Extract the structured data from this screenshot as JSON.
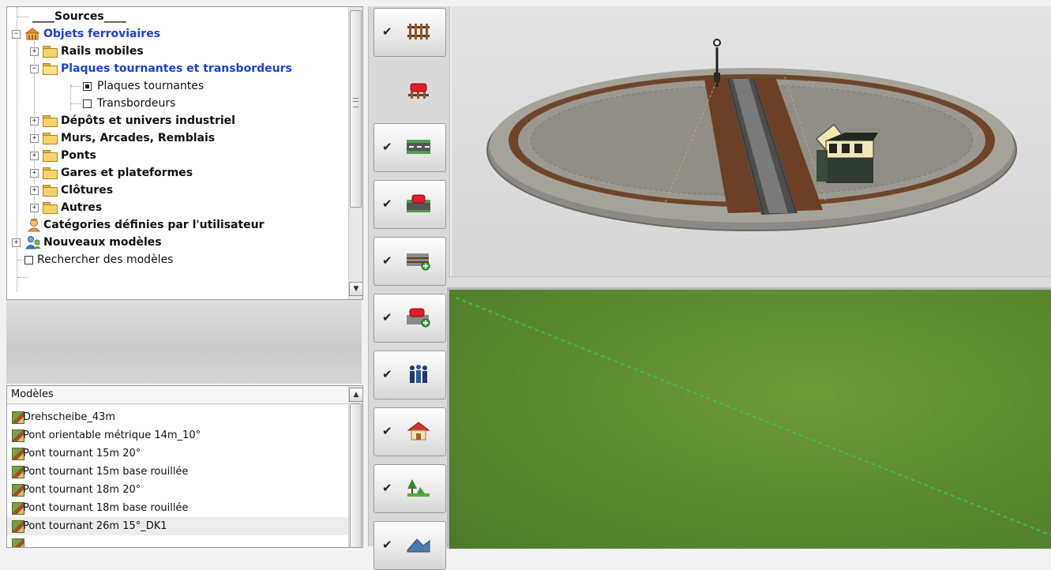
{
  "tree": {
    "items": [
      {
        "label": "____Sources____",
        "level": 1,
        "style": "bold",
        "icon": "none",
        "expander": "none"
      },
      {
        "label": "Objets ferroviaires",
        "level": 0,
        "style": "bold-blue",
        "icon": "railway-objects-icon",
        "expander": "minus"
      },
      {
        "label": "Rails mobiles",
        "level": 1,
        "style": "bold",
        "icon": "folder-icon",
        "expander": "plus"
      },
      {
        "label": "Plaques tournantes et transbordeurs",
        "level": 1,
        "style": "bold-blue",
        "icon": "folder-open-icon",
        "expander": "minus"
      },
      {
        "label": "Plaques tournantes",
        "level": 2,
        "style": "plain",
        "icon": "checkbox-checked",
        "expander": "none"
      },
      {
        "label": "Transbordeurs",
        "level": 2,
        "style": "plain",
        "icon": "checkbox-empty",
        "expander": "none"
      },
      {
        "label": "Dépôts et univers industriel",
        "level": 1,
        "style": "bold",
        "icon": "folder-icon",
        "expander": "plus"
      },
      {
        "label": "Murs, Arcades, Remblais",
        "level": 1,
        "style": "bold",
        "icon": "folder-icon",
        "expander": "plus"
      },
      {
        "label": "Ponts",
        "level": 1,
        "style": "bold",
        "icon": "folder-icon",
        "expander": "plus"
      },
      {
        "label": "Gares et plateformes",
        "level": 1,
        "style": "bold",
        "icon": "folder-icon",
        "expander": "plus"
      },
      {
        "label": "Clôtures",
        "level": 1,
        "style": "bold",
        "icon": "folder-icon",
        "expander": "plus"
      },
      {
        "label": "Autres",
        "level": 1,
        "style": "bold",
        "icon": "folder-icon",
        "expander": "plus"
      },
      {
        "label": "Catégories définies par l'utilisateur",
        "level": 0,
        "style": "bold",
        "icon": "user-icon",
        "expander": "none"
      },
      {
        "label": "Nouveaux modèles",
        "level": 0,
        "style": "bold",
        "icon": "new-models-icon",
        "expander": "plus"
      },
      {
        "label": "Rechercher des modèles",
        "level": 0,
        "style": "plain",
        "icon": "checkbox-empty",
        "expander": "none"
      }
    ]
  },
  "models": {
    "header": "Modèles",
    "items": [
      "Drehscheibe_43m",
      "Pont orientable métrique 14m_10°",
      "Pont tournant 15m 20°",
      "Pont tournant 15m base rouillée",
      "Pont tournant 18m 20°",
      "Pont tournant 18m base rouillée",
      "Pont tournant 26m 15°_DK1"
    ],
    "selected_index": 6
  },
  "toolbar": {
    "buttons": [
      {
        "name": "tool-track",
        "icon": "track-icon",
        "checked": true
      },
      {
        "name": "tool-rolling-stock",
        "icon": "rolling-stock-icon",
        "checked": false
      },
      {
        "name": "tool-road",
        "icon": "road-icon",
        "checked": true
      },
      {
        "name": "tool-road-vehicle",
        "icon": "road-vehicle-icon",
        "checked": true
      },
      {
        "name": "tool-tram",
        "icon": "tram-icon",
        "checked": true
      },
      {
        "name": "tool-tram-vehicle",
        "icon": "tram-vehicle-icon",
        "checked": true
      },
      {
        "name": "tool-people",
        "icon": "people-icon",
        "checked": true
      },
      {
        "name": "tool-house",
        "icon": "house-icon",
        "checked": true
      },
      {
        "name": "tool-landscape",
        "icon": "landscape-icon",
        "checked": true
      },
      {
        "name": "tool-terrain",
        "icon": "terrain-icon",
        "checked": true
      }
    ],
    "check_glyph": "✔"
  },
  "colors": {
    "tree_blue": "#1e3fd6",
    "terrain_green": "#5b8a2f",
    "guide_line": "#2fcf5a"
  }
}
